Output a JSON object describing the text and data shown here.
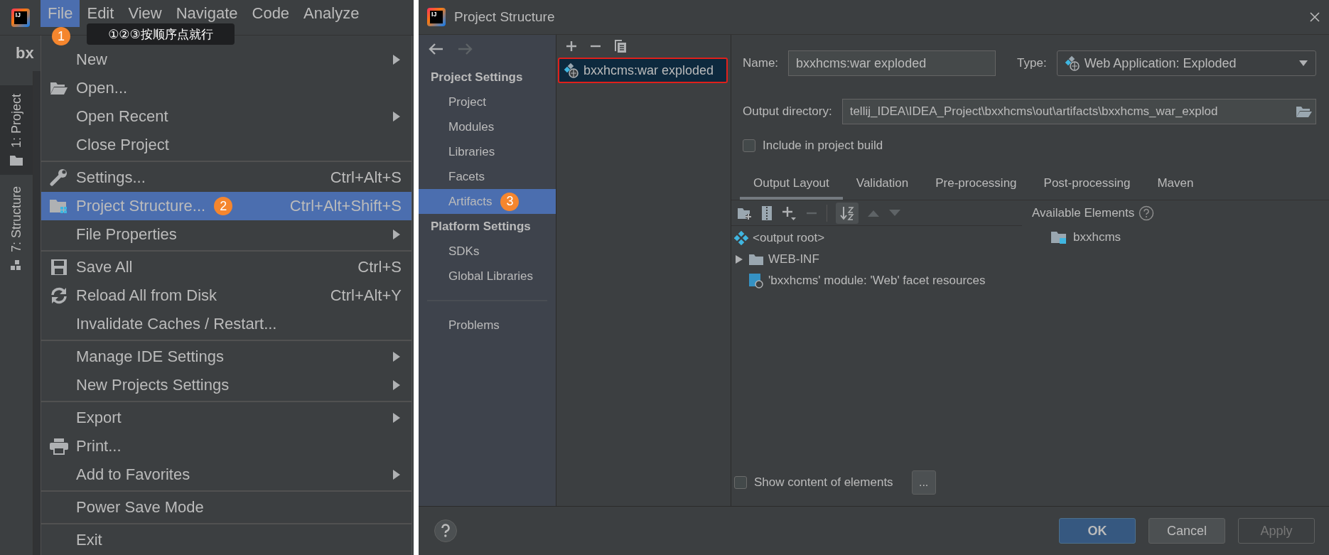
{
  "ide": {
    "logo": "IJ",
    "menubar": [
      {
        "label": "File",
        "selected": true,
        "badge": "1"
      },
      {
        "label": "Edit",
        "selected": false
      },
      {
        "label": "View",
        "selected": false
      },
      {
        "label": "Navigate",
        "selected": false
      },
      {
        "label": "Code",
        "selected": false
      },
      {
        "label": "Analyze",
        "selected": false
      }
    ],
    "editor_tab": "bx",
    "tool_windows": [
      {
        "label": "1: Project",
        "selected": true
      },
      {
        "label": "7: Structure",
        "selected": false
      }
    ]
  },
  "tooltip": "①②③按顺序点就行",
  "file_menu": [
    {
      "kind": "item",
      "label": "New",
      "submenu": true,
      "selected": false
    },
    {
      "kind": "item",
      "label": "Open...",
      "submenu": false,
      "selected": false
    },
    {
      "kind": "item",
      "label": "Open Recent",
      "submenu": true,
      "selected": false
    },
    {
      "kind": "item",
      "label": "Close Project",
      "submenu": false,
      "selected": false
    },
    {
      "kind": "separator"
    },
    {
      "kind": "item",
      "label": "Settings...",
      "shortcut": "Ctrl+Alt+S",
      "submenu": false,
      "selected": false
    },
    {
      "kind": "item",
      "label": "Project Structure...",
      "shortcut": "Ctrl+Alt+Shift+S",
      "submenu": false,
      "selected": true,
      "badge": "2"
    },
    {
      "kind": "item",
      "label": "File Properties",
      "submenu": true,
      "selected": false
    },
    {
      "kind": "separator"
    },
    {
      "kind": "item",
      "label": "Save All",
      "shortcut": "Ctrl+S",
      "submenu": false,
      "selected": false
    },
    {
      "kind": "item",
      "label": "Reload All from Disk",
      "shortcut": "Ctrl+Alt+Y",
      "submenu": false,
      "selected": false
    },
    {
      "kind": "item",
      "label": "Invalidate Caches / Restart...",
      "submenu": false,
      "selected": false
    },
    {
      "kind": "separator"
    },
    {
      "kind": "item",
      "label": "Manage IDE Settings",
      "submenu": true,
      "selected": false
    },
    {
      "kind": "item",
      "label": "New Projects Settings",
      "submenu": true,
      "selected": false
    },
    {
      "kind": "separator"
    },
    {
      "kind": "item",
      "label": "Export",
      "submenu": true,
      "selected": false
    },
    {
      "kind": "item",
      "label": "Print...",
      "submenu": false,
      "selected": false
    },
    {
      "kind": "item",
      "label": "Add to Favorites",
      "submenu": true,
      "selected": false
    },
    {
      "kind": "separator"
    },
    {
      "kind": "item",
      "label": "Power Save Mode",
      "submenu": false,
      "selected": false
    },
    {
      "kind": "separator"
    },
    {
      "kind": "item",
      "label": "Exit",
      "submenu": false,
      "selected": false
    }
  ],
  "dialog": {
    "logo": "IJ",
    "title": "Project Structure",
    "sidebar": [
      {
        "heading": "Project Settings",
        "items": [
          {
            "label": "Project",
            "selected": false
          },
          {
            "label": "Modules",
            "selected": false
          },
          {
            "label": "Libraries",
            "selected": false
          },
          {
            "label": "Facets",
            "selected": false
          },
          {
            "label": "Artifacts",
            "selected": true,
            "badge": "3"
          }
        ]
      },
      {
        "heading": "Platform Settings",
        "items": [
          {
            "label": "SDKs",
            "selected": false
          },
          {
            "label": "Global Libraries",
            "selected": false
          }
        ]
      },
      {
        "items": [
          {
            "label": "Problems",
            "selected": false
          }
        ]
      }
    ],
    "artifacts": [
      {
        "label": "bxxhcms:war exploded",
        "selected": true,
        "outlined": true
      }
    ],
    "name": {
      "label": "Name:",
      "value": "bxxhcms:war exploded"
    },
    "type": {
      "label": "Type:",
      "value": "Web Application: Exploded"
    },
    "output_directory": {
      "label": "Output directory:",
      "value": "tellij_IDEA\\IDEA_Project\\bxxhcms\\out\\artifacts\\bxxhcms_war_explod"
    },
    "include_in_build": {
      "label": "Include in project build",
      "checked": false
    },
    "tabs": [
      {
        "label": "Output Layout",
        "selected": true
      },
      {
        "label": "Validation",
        "selected": false
      },
      {
        "label": "Pre-processing",
        "selected": false
      },
      {
        "label": "Post-processing",
        "selected": false
      },
      {
        "label": "Maven",
        "selected": false
      }
    ],
    "layout_tree": [
      {
        "kind": "root",
        "label": "<output root>"
      },
      {
        "kind": "folder",
        "label": "WEB-INF",
        "expanded": false
      },
      {
        "kind": "module",
        "label": "'bxxhcms' module: 'Web' facet resources"
      }
    ],
    "available_elements": {
      "title": "Available Elements",
      "items": [
        {
          "label": "bxxhcms"
        }
      ]
    },
    "show_content": {
      "label": "Show content of elements",
      "checked": false
    },
    "more_button": "...",
    "buttons": [
      {
        "label": "OK",
        "kind": "primary",
        "disabled": false
      },
      {
        "label": "Cancel",
        "kind": "normal",
        "disabled": false
      },
      {
        "label": "Apply",
        "kind": "normal",
        "disabled": true
      }
    ]
  }
}
